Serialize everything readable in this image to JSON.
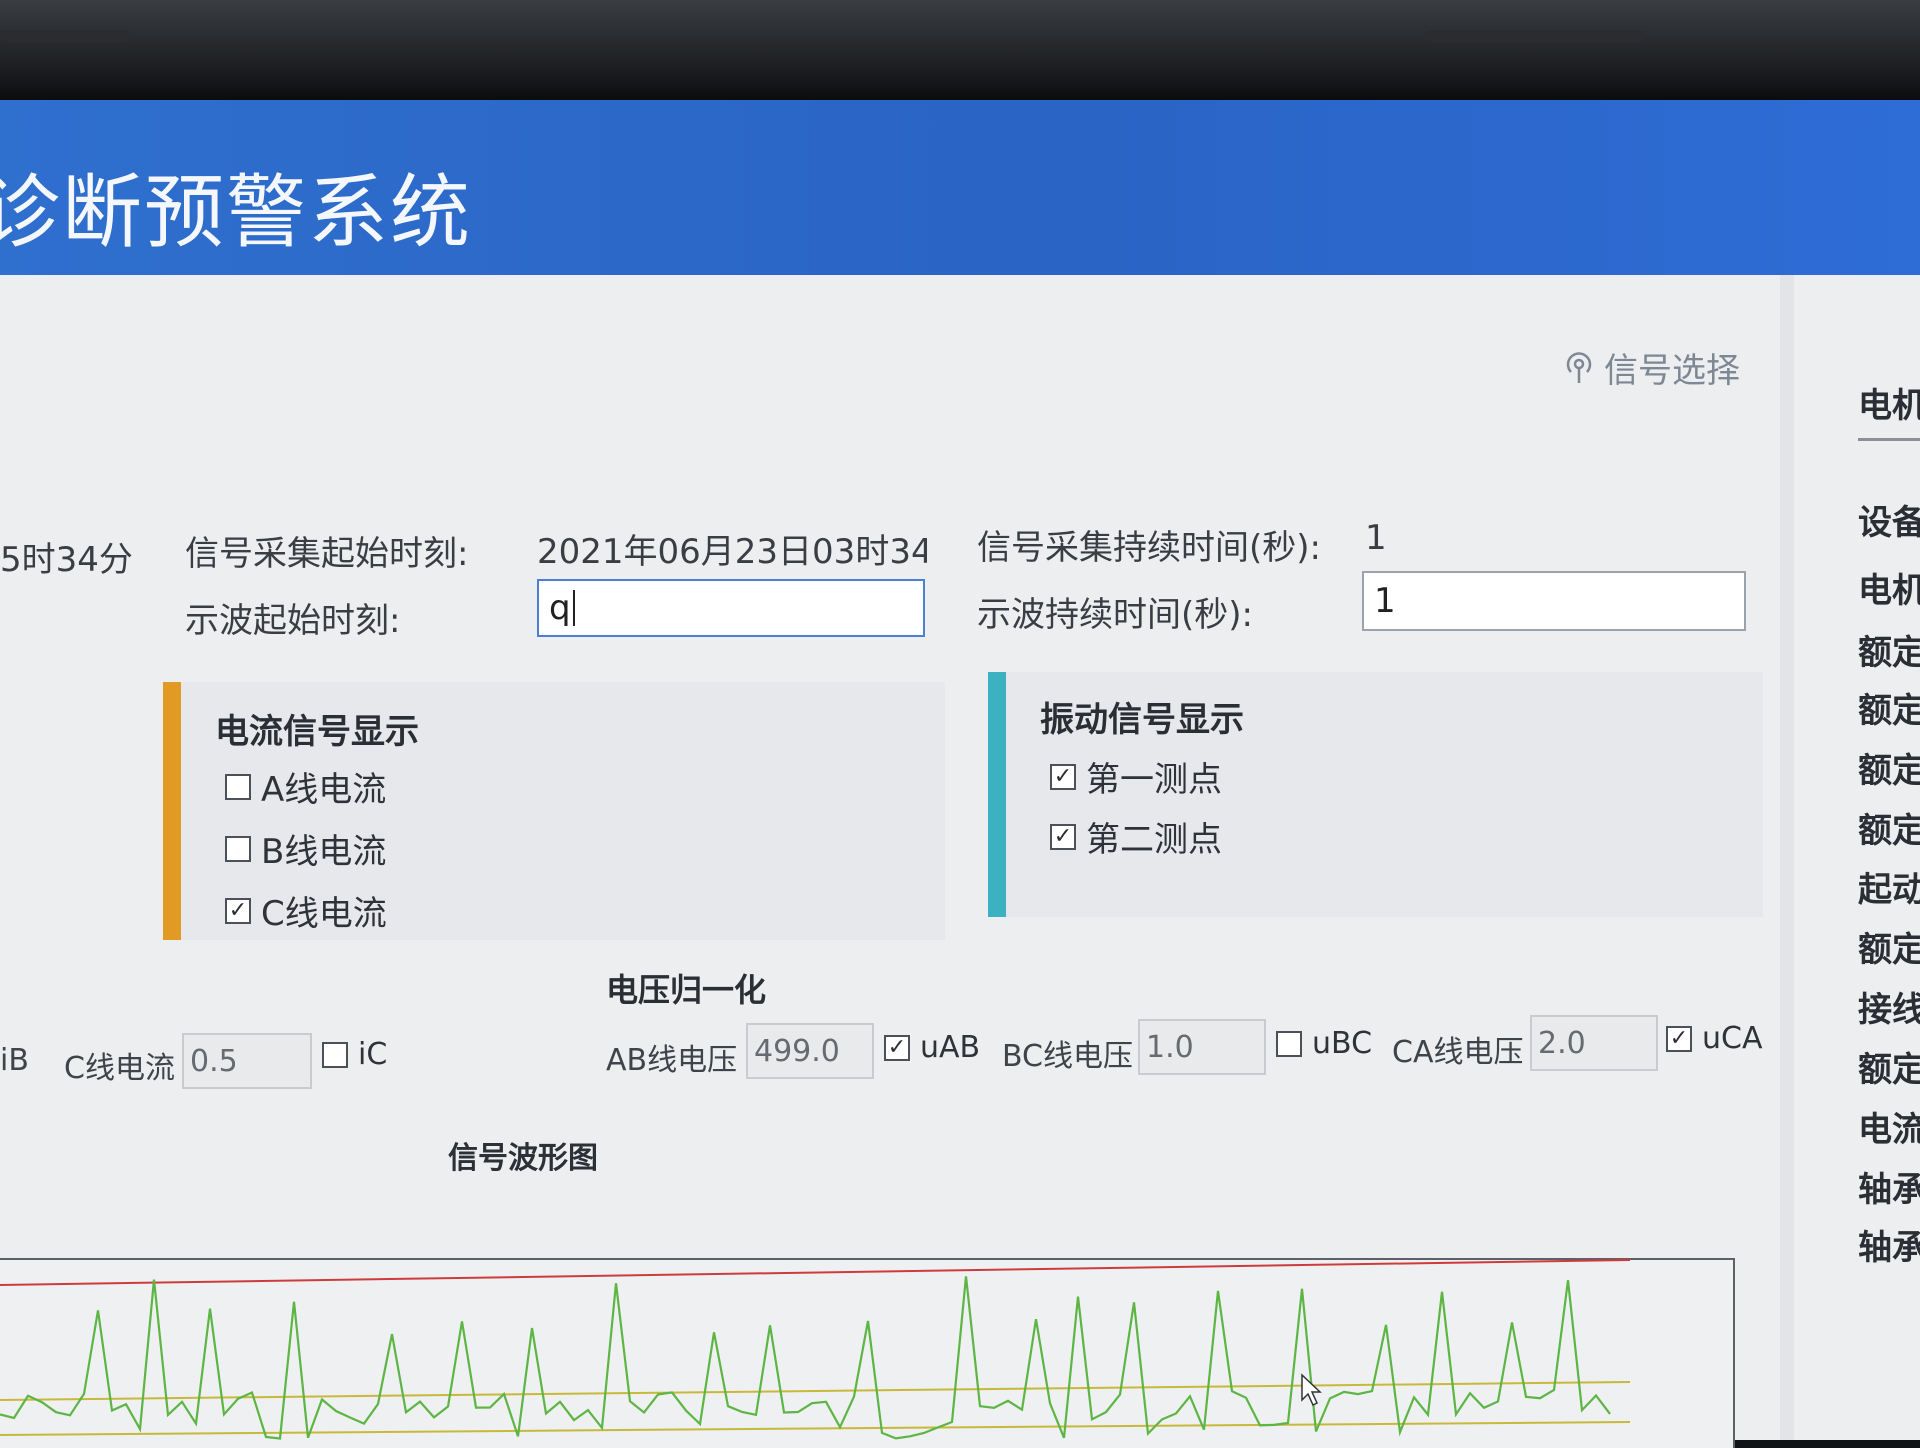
{
  "app": {
    "title": "诊断预警系统"
  },
  "header": {
    "signal_select": "信号选择"
  },
  "form": {
    "prev_time_fragment": "5时34分",
    "acq_start_label": "信号采集起始时刻:",
    "acq_start_value": "2021年06月23日03时34",
    "acq_duration_label": "信号采集持续时间(秒):",
    "acq_duration_value": "1",
    "osc_start_label": "示波起始时刻:",
    "osc_start_value": "q",
    "osc_duration_label": "示波持续时间(秒):",
    "osc_duration_value": "1"
  },
  "current_panel": {
    "title": "电流信号显示",
    "accent": "#e19a23",
    "items": [
      {
        "label": "A线电流",
        "checked": false
      },
      {
        "label": "B线电流",
        "checked": false
      },
      {
        "label": "C线电流",
        "checked": true
      }
    ]
  },
  "vibration_panel": {
    "title": "振动信号显示",
    "accent": "#3bb1c2",
    "items": [
      {
        "label": "第一测点",
        "checked": true
      },
      {
        "label": "第二测点",
        "checked": true
      }
    ]
  },
  "current_norm": {
    "ib_label": "iB",
    "c_label": "C线电流",
    "c_value": "0.5",
    "ic_label": "iC",
    "ic_checked": false
  },
  "voltage_norm": {
    "title": "电压归一化",
    "ab_label": "AB线电压",
    "ab_value": "499.0",
    "uab_label": "uAB",
    "uab_checked": true,
    "bc_label": "BC线电压",
    "bc_value": "1.0",
    "ubc_label": "uBC",
    "ubc_checked": false,
    "ca_label": "CA线电压",
    "ca_value": "2.0",
    "uca_label": "uCA",
    "uca_checked": true
  },
  "waveform": {
    "title": "信号波形图",
    "colors": {
      "signal": "#5db544",
      "limit_high": "#cf3b3b",
      "limit_mid": "#c9b93a"
    }
  },
  "right_sidebar": {
    "items": [
      "电机",
      "设备",
      "电机",
      "额定",
      "额定",
      "额定",
      "额定",
      "起动",
      "额定",
      "接线",
      "额定",
      "电流",
      "轴承",
      "轴承"
    ]
  },
  "check_glyph": "✓"
}
